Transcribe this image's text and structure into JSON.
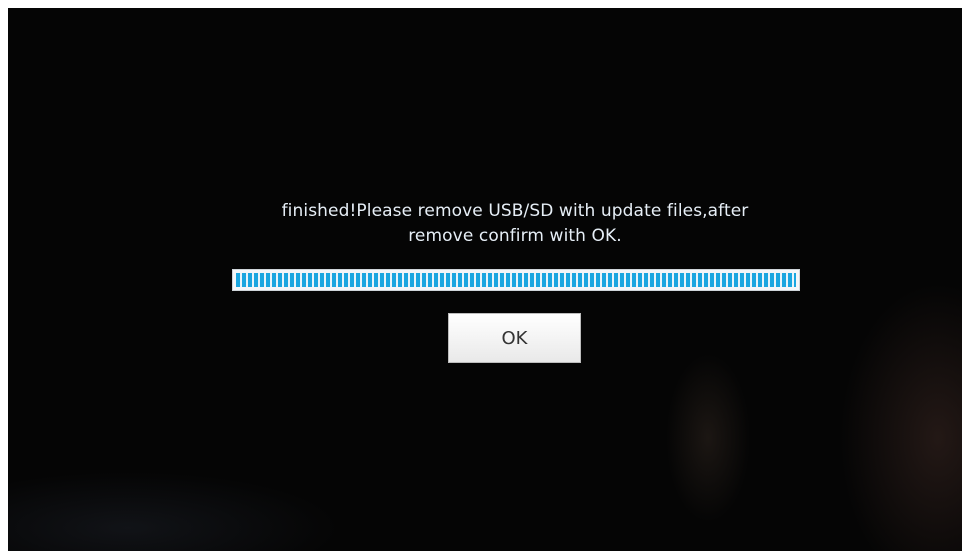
{
  "dialog": {
    "message_line1": "finished!Please remove USB/SD with update files,after",
    "message_line2": "remove confirm with OK.",
    "progress": 1.0,
    "ok_label": "OK"
  },
  "colors": {
    "background": "#050505",
    "text": "#e6eef6",
    "progress_accent": "#1aa6e0",
    "button_face": "#f2f2f2"
  }
}
